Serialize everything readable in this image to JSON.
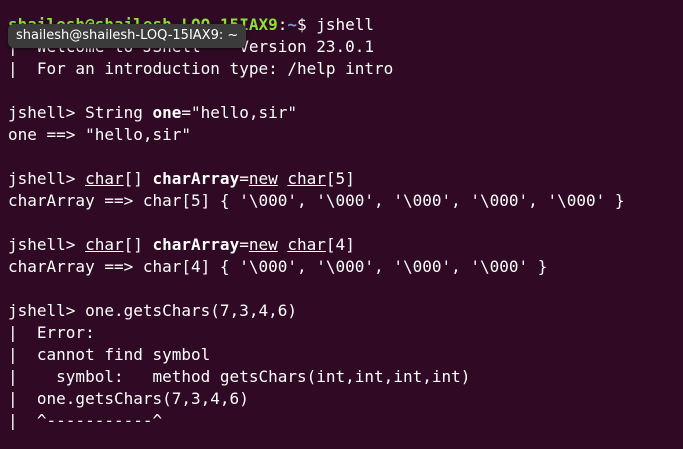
{
  "tooltip": {
    "text": "shailesh@shailesh-LOQ-15IAX9: ~"
  },
  "shell_prompt": {
    "user_host": "shailesh@shailesh-LOQ-15IAX9",
    "colon": ":",
    "path": "~",
    "dollar": "$ ",
    "command": "jshell"
  },
  "banner": {
    "welcome": "|  Welcome to JShell -- Version 23.0.1",
    "intro": "|  For an introduction type: /help intro"
  },
  "jshell_prompt": "jshell> ",
  "entries": {
    "e1": {
      "type_kw": "String ",
      "var": "one",
      "rest": "=\"hello,sir\"",
      "output": "one ==> \"hello,sir\""
    },
    "e2": {
      "type": "char",
      "type_rest": "[] ",
      "var": "charArray",
      "eq": "=",
      "new_kw": "new",
      "space": " ",
      "type2": "char",
      "size": "[5]",
      "output": "charArray ==> char[5] { '\\000', '\\000', '\\000', '\\000', '\\000' }"
    },
    "e3": {
      "type": "char",
      "type_rest": "[] ",
      "var": "charArray",
      "eq": "=",
      "new_kw": "new",
      "space": " ",
      "type2": "char",
      "size": "[4]",
      "output": "charArray ==> char[4] { '\\000', '\\000', '\\000', '\\000' }"
    },
    "e4": {
      "input": "one.getsChars(7,3,4,6)"
    }
  },
  "error": {
    "line1": "|  Error:",
    "line2": "|  cannot find symbol",
    "line3": "|    symbol:   method getsChars(int,int,int,int)",
    "line4": "|  one.getsChars(7,3,4,6)",
    "line5": "|  ^-----------^"
  },
  "colors": {
    "background": "#300a24",
    "prompt_user": "#8ae234",
    "prompt_path": "#729fcf",
    "text": "#ffffff"
  }
}
